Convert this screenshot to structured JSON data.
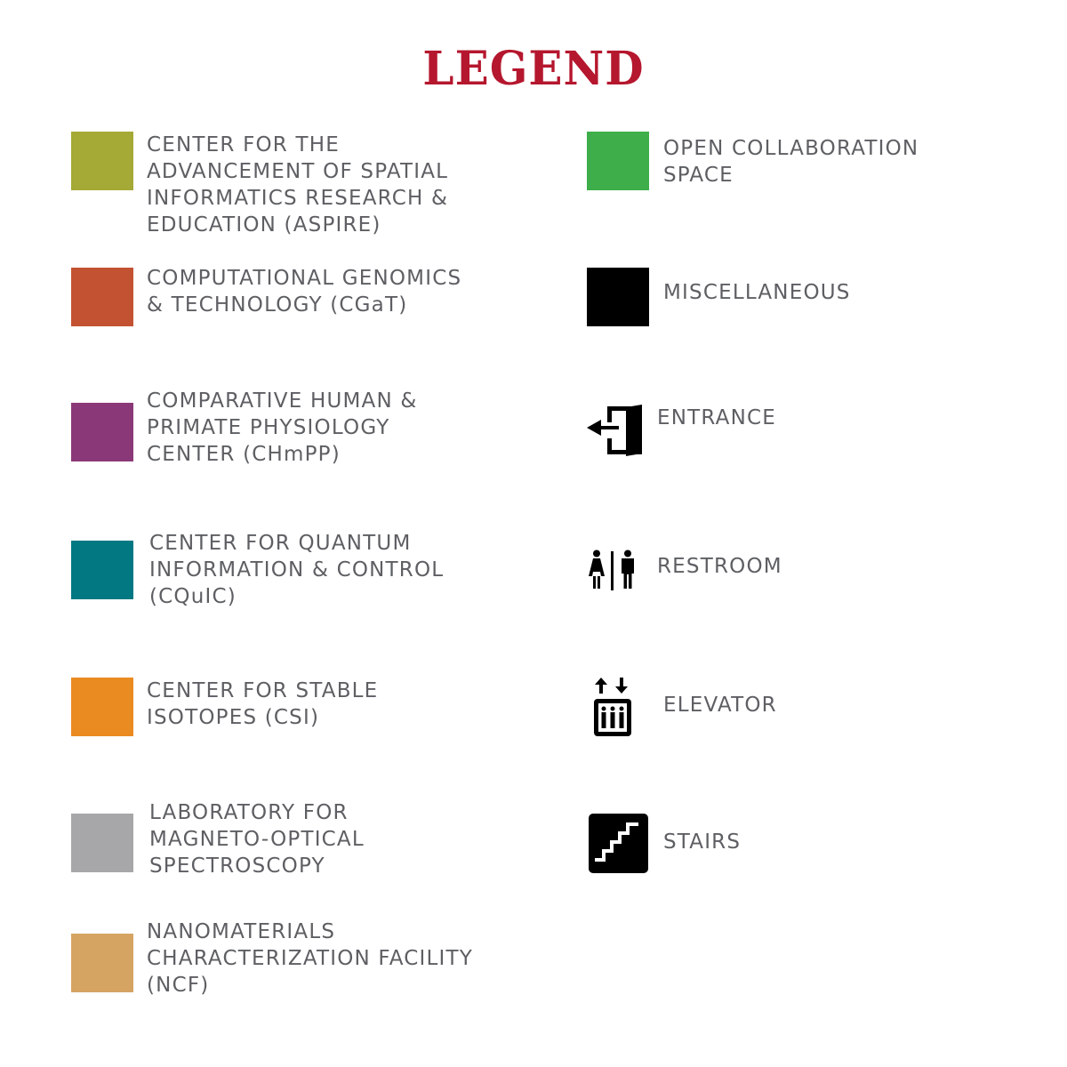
{
  "legend": {
    "title": "LEGEND",
    "title_color": "#b5172e",
    "text_color": "#5d5f63",
    "left_items": [
      {
        "label": "CENTER FOR THE\nADVANCEMENT OF SPATIAL\nINFORMATICS RESEARCH &\nEDUCATION (ASPIRE)",
        "color": "#a5a936"
      },
      {
        "label": "COMPUTATIONAL GENOMICS\n& TECHNOLOGY (CGaT)",
        "color": "#c35232"
      },
      {
        "label": "COMPARATIVE HUMAN &\nPRIMATE PHYSIOLOGY\nCENTER (CHmPP)",
        "color": "#8b3878"
      },
      {
        "label": "CENTER FOR QUANTUM\nINFORMATION & CONTROL\n(CQuIC)",
        "color": "#027883"
      },
      {
        "label": "CENTER FOR STABLE\nISOTOPES (CSI)",
        "color": "#ea8b22"
      },
      {
        "label": "LABORATORY FOR\nMAGNETO-OPTICAL\nSPECTROSCOPY",
        "color": "#a7a7a9"
      },
      {
        "label": "NANOMATERIALS\nCHARACTERIZATION FACILITY\n(NCF)",
        "color": "#d5a463"
      }
    ],
    "right_items": [
      {
        "label": "OPEN COLLABORATION\nSPACE",
        "color": "#3dae49",
        "icon": "green-swatch"
      },
      {
        "label": "MISCELLANEOUS",
        "color": "#000000",
        "icon": "black-swatch"
      },
      {
        "label": "ENTRANCE",
        "icon": "entrance-icon"
      },
      {
        "label": "RESTROOM",
        "icon": "restroom-icon"
      },
      {
        "label": "ELEVATOR",
        "icon": "elevator-icon"
      },
      {
        "label": "STAIRS",
        "icon": "stairs-icon"
      }
    ]
  }
}
